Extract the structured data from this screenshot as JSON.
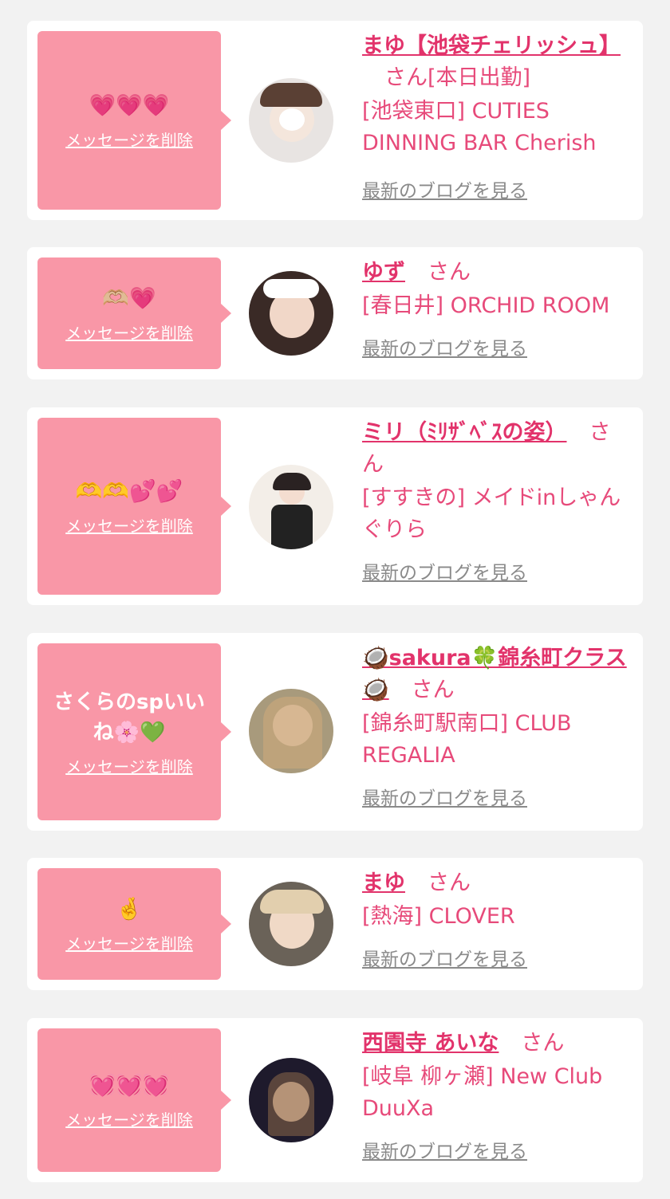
{
  "colors": {
    "page_bg": "#f2f2f2",
    "card_bg": "#ffffff",
    "bubble_bg": "#f997a7",
    "name_color": "#e2336b",
    "store_color": "#e74a7a",
    "blog_link_color": "#8a8a8a"
  },
  "labels": {
    "delete": "メッセージを削除",
    "blog": "最新のブログを見る",
    "honorific": "さん"
  },
  "cards": [
    {
      "message": "💗💗💗",
      "name": "まゆ【池袋チェリッシュ】",
      "store": "[池袋東口] CUTIES DINNING BAR Cherish",
      "name_suffix": "[本日出勤]",
      "avatar_icon": "avatar-photo"
    },
    {
      "message": "🫶🏼💗",
      "name": "ゆず",
      "store": "[春日井] ORCHID ROOM",
      "name_suffix": "",
      "avatar_icon": "avatar-photo"
    },
    {
      "message": "🫶🫶💕💕",
      "name": "ミリ（ﾐﾘｻﾞﾍﾞｽの姿）",
      "store": "[すすきの] メイドinしゃんぐりら",
      "name_suffix": "",
      "avatar_icon": "avatar-photo"
    },
    {
      "message": "さくらのspいいね🌸💚",
      "name": "🥥sakura🍀錦糸町クラス🥥",
      "store": "[錦糸町駅南口] CLUB REGALIA",
      "name_suffix": "",
      "avatar_icon": "avatar-photo"
    },
    {
      "message": "🤞",
      "name": "まゆ",
      "store": "[熱海] CLOVER",
      "name_suffix": "",
      "avatar_icon": "avatar-photo"
    },
    {
      "message": "💓💓💓",
      "name": "西園寺 あいな",
      "store": "[岐阜 柳ヶ瀬] New Club DuuXa",
      "name_suffix": "",
      "avatar_icon": "avatar-photo"
    }
  ]
}
